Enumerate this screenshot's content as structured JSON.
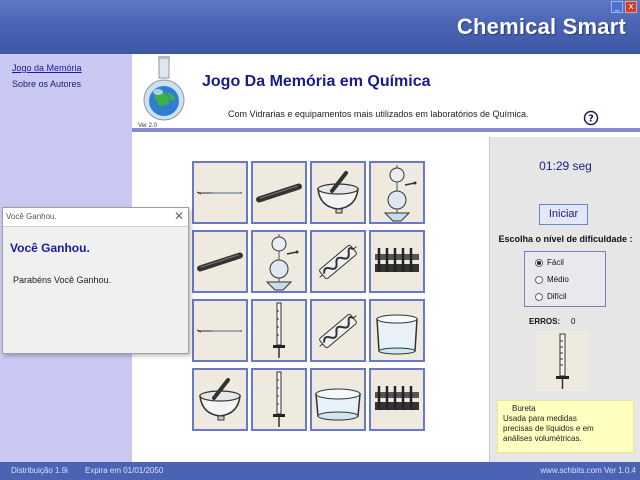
{
  "window": {
    "app_title": "Chemical Smart",
    "minimize_label": "_",
    "close_label": "x"
  },
  "sidebar": {
    "items": [
      {
        "label": "Jogo da Memória"
      },
      {
        "label": "Sobre os Autores"
      }
    ]
  },
  "header": {
    "version": "Ver 2.0",
    "title": "Jogo Da Memória em Química",
    "subtitle": "Com Vidrarias e equipamentos mais utilizados em laboratórios de Química."
  },
  "board": {
    "cards": [
      [
        "pipette",
        "rod",
        "mortar",
        "separatory-funnel"
      ],
      [
        "rod",
        "separatory-funnel",
        "condenser",
        "test-tube-rack"
      ],
      [
        "pipette",
        "burette",
        "condenser",
        "beaker"
      ],
      [
        "mortar",
        "burette",
        "crystallizer",
        "test-tube-rack"
      ]
    ]
  },
  "panel": {
    "timer": "01:29 seg",
    "start_label": "Iniciar",
    "difficulty_label": "Escolha o nível de dificuldade :",
    "difficulties": [
      {
        "label": "Fácil",
        "selected": true
      },
      {
        "label": "Médio",
        "selected": false
      },
      {
        "label": "Difícil",
        "selected": false
      }
    ],
    "errors_label": "ERROS:",
    "errors_value": "0",
    "info_title": "Bureta",
    "info_text_1": "Usada para medidas",
    "info_text_2": "precisas de líquidos e em",
    "info_text_3": "análises volumétricas."
  },
  "footer": {
    "distribution": "Distribuição 1.9i",
    "expires": "Expira em 01/01/2050",
    "site": "www.schbits.com Ver 1.0.4"
  },
  "dialog": {
    "title": "Você Ganhou.",
    "heading": "Você Ganhou.",
    "message": "Parabéns Você Ganhou.",
    "close_label": "✕"
  },
  "colors": {
    "titlebar": "#4a63b3",
    "sidebar": "#c9c9f4",
    "card_border": "#6b78c8",
    "info_bg": "#ffffc0"
  }
}
